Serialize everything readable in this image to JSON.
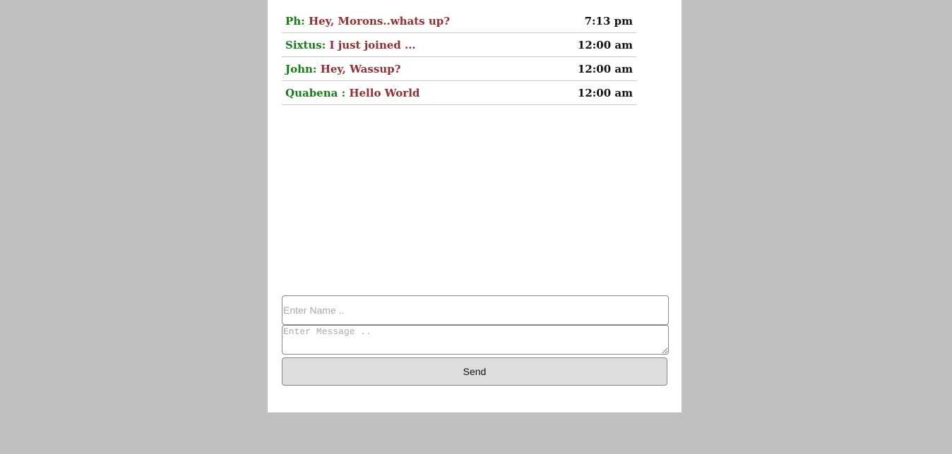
{
  "messages": [
    {
      "sender": "Ph:",
      "text": "Hey, Morons..whats up?",
      "time": "7:13 pm"
    },
    {
      "sender": "Sixtus:",
      "text": "I just joined ...",
      "time": "12:00 am"
    },
    {
      "sender": "John:",
      "text": "Hey, Wassup?",
      "time": "12:00 am"
    },
    {
      "sender": "Quabena :",
      "text": "Hello World",
      "time": "12:00 am"
    }
  ],
  "form": {
    "name_placeholder": "Enter Name ..",
    "name_value": "",
    "message_placeholder": "Enter Message ..",
    "message_value": "",
    "send_label": "Send"
  },
  "colors": {
    "background": "#c0c0c0",
    "panel": "#ffffff",
    "sender": "#138013",
    "message_text": "#9a2b2b",
    "button_bg": "#dddddd"
  }
}
